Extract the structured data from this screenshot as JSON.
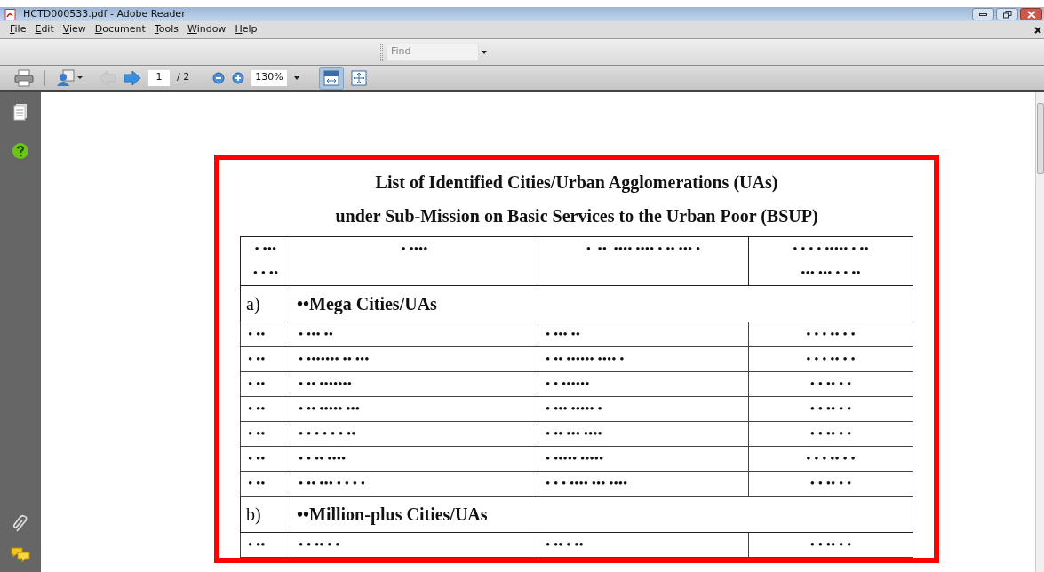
{
  "window": {
    "title": "HCTD000533.pdf - Adobe Reader"
  },
  "menu": [
    "File",
    "Edit",
    "View",
    "Document",
    "Tools",
    "Window",
    "Help"
  ],
  "find": {
    "placeholder": "Find"
  },
  "toolbar": {
    "page": "1",
    "page_total": "/ 2",
    "zoom": "130%",
    "fit_width_selected": true
  },
  "document": {
    "title": "List of Identified Cities/Urban Agglomerations (UAs)",
    "subtitle": "under Sub-Mission on Basic Services to the Urban Poor (BSUP)",
    "header": [
      [
        "• •••",
        "• • ••"
      ],
      [
        "• ••••"
      ],
      [
        "•  ••  •••• •••• • •• ••• •"
      ],
      [
        "• • • • ••••• • ••",
        "••• ••• • • ••"
      ]
    ],
    "sections": [
      {
        "label": "a)",
        "heading": "••Mega Cities/UAs",
        "rows": [
          [
            "• ••",
            "• ••• ••",
            "• ••• ••",
            "• • • •• • •"
          ],
          [
            "• ••",
            "• ••••••• •• •••",
            "• •• •••••• •••• •",
            "• • • •• • •"
          ],
          [
            "• ••",
            "• •• •••••••",
            "• • ••••••",
            "• • •• • •"
          ],
          [
            "• ••",
            "• •• ••••• •••",
            "• ••• ••••• •",
            "• • •• • •"
          ],
          [
            "• ••",
            "• • • • • • ••",
            "• •• ••• ••••",
            "• • •• • •"
          ],
          [
            "• ••",
            "• • •• ••••",
            "• ••••• •••••",
            "• • • •• • •"
          ],
          [
            "• ••",
            "• •• ••• • • • •",
            "• • • •••• ••• ••••",
            "• • •• • •"
          ]
        ]
      },
      {
        "label": "b)",
        "heading": "••Million-plus Cities/UAs",
        "rows": [
          [
            "• ••",
            "• • •• • •",
            "• •• • ••",
            "• • •• • •"
          ]
        ]
      }
    ]
  }
}
